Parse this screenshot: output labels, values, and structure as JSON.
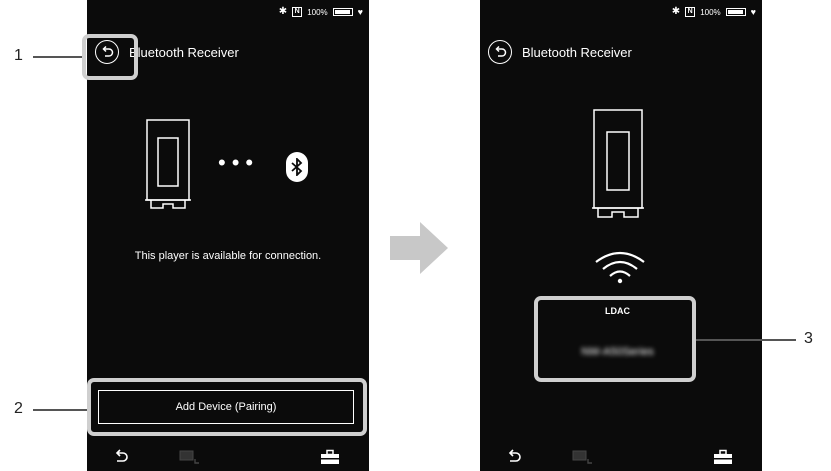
{
  "left_screen": {
    "status": {
      "bluetooth": "✱",
      "nfc": "N",
      "battery_text": "100%",
      "heart": "♥"
    },
    "title": "Bluetooth Receiver",
    "message": "This player is available for connection.",
    "add_device_label": "Add Device (Pairing)",
    "dots": "•••"
  },
  "right_screen": {
    "status": {
      "bluetooth": "✱",
      "nfc": "N",
      "battery_text": "100%",
      "heart": "♥"
    },
    "title": "Bluetooth Receiver",
    "codec": "LDAC",
    "device_name": "NW-A50Series"
  },
  "callouts": [
    "1",
    "2",
    "3"
  ],
  "colors": {
    "screen_bg": "#0b0b0b",
    "callout_border": "#cfcfcf",
    "arrow": "#c8c8c8"
  }
}
